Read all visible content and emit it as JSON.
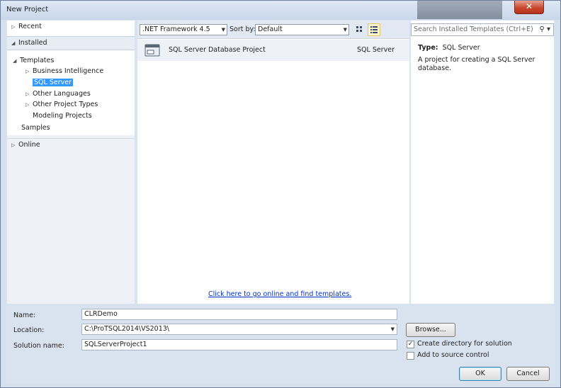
{
  "window": {
    "title": "New Project"
  },
  "nav": {
    "recent": "Recent",
    "installed": "Installed",
    "templates": "Templates",
    "items": [
      "Business Intelligence",
      "SQL Server",
      "Other Languages",
      "Other Project Types",
      "Modeling Projects"
    ],
    "samples": "Samples",
    "online": "Online"
  },
  "toolbar": {
    "framework": ".NET Framework 4.5",
    "sort_label": "Sort by:",
    "sort_value": "Default"
  },
  "templates": [
    {
      "name": "SQL Server Database Project",
      "type": "SQL Server"
    }
  ],
  "online_link": "Click here to go online and find templates.",
  "search": {
    "placeholder": "Search Installed Templates (Ctrl+E)"
  },
  "description": {
    "type_label": "Type:",
    "type_value": "SQL Server",
    "text": "A project for creating a SQL Server database."
  },
  "form": {
    "name_label": "Name:",
    "name_value": "CLRDemo",
    "location_label": "Location:",
    "location_value": "C:\\ProTSQL2014\\VS2013\\",
    "solution_label": "Solution name:",
    "solution_value": "SQLServerProject1",
    "browse": "Browse...",
    "create_dir": "Create directory for solution",
    "create_dir_checked": true,
    "source_control": "Add to source control",
    "source_control_checked": false,
    "ok": "OK",
    "cancel": "Cancel"
  },
  "colors": {
    "selection": "#3399ff",
    "link": "#0033cc",
    "close": "#c7492f"
  }
}
